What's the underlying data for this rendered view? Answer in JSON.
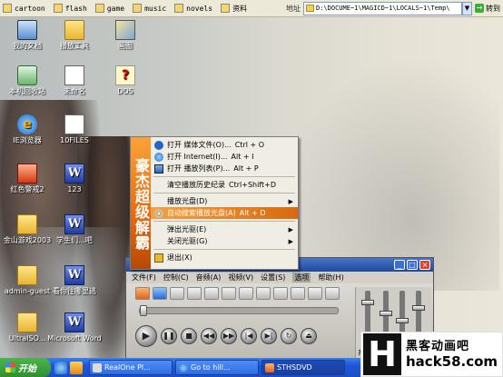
{
  "topbar": {
    "quick_tabs": [
      {
        "label": "cartoon"
      },
      {
        "label": "flash"
      },
      {
        "label": "game"
      },
      {
        "label": "music"
      },
      {
        "label": "novels"
      },
      {
        "label": "资料"
      }
    ],
    "address_label": "地址",
    "address_value": "D:\\DOCUME~1\\MAGICD~1\\LOCALS~1\\Temp\\",
    "go_label": "转到"
  },
  "desktop_icons": [
    {
      "label": "我的文档"
    },
    {
      "label": "播放工具"
    },
    {
      "label": "画图"
    },
    {
      "label": "本机回收站"
    },
    {
      "label": "未命名"
    },
    {
      "label": "DOS"
    },
    {
      "label": "IE浏览器"
    },
    {
      "label": "10FILES"
    },
    {
      "label": "红色警戒2"
    },
    {
      "label": "123"
    },
    {
      "label": "金山游戏2003"
    },
    {
      "label": "学生们、大家都爱"
    },
    {
      "label": "学生们...吧"
    },
    {
      "label": "admin-guest"
    },
    {
      "label": "看你往哪里逃"
    },
    {
      "label": "UltraISO..."
    },
    {
      "label": "Microsoft Word"
    }
  ],
  "context_menu": {
    "band_text": "豪杰超级解霸",
    "items": [
      {
        "label": "打开 媒体文件(O)...",
        "shortcut": "Ctrl + O"
      },
      {
        "label": "打开 Internet(I)...",
        "shortcut": "Alt + I"
      },
      {
        "label": "打开 播放列表(P)...",
        "shortcut": "Alt + P"
      },
      {
        "label": "清空播放历史纪录",
        "shortcut": "Ctrl+Shift+D"
      },
      {
        "label": "播放光盘(D)",
        "shortcut": ""
      },
      {
        "label": "自动搜索播放光盘(A)",
        "shortcut": "Alt + D"
      },
      {
        "label": "弹出光驱(E)",
        "shortcut": ""
      },
      {
        "label": "关闭光驱(G)",
        "shortcut": ""
      },
      {
        "label": "退出(X)",
        "shortcut": ""
      }
    ]
  },
  "player": {
    "menu": [
      "文件(F)",
      "控制(C)",
      "音频(A)",
      "视频(V)",
      "设置(S)",
      "选项",
      "帮助(H)"
    ],
    "eq_label": "系统"
  },
  "taskbar": {
    "start_label": "开始",
    "tasks": [
      {
        "label": "RealOne Pl..."
      },
      {
        "label": "Go to hill..."
      },
      {
        "label": "STHSDVD"
      }
    ]
  },
  "watermark": {
    "letter": "H",
    "line1": "黑客动画吧",
    "line2": "hack58.com"
  },
  "colors": {
    "menu_band": "#e66b10",
    "menu_selected": "#d86a12",
    "taskbar": "#1f56d8",
    "start_button": "#2f8f2f"
  }
}
